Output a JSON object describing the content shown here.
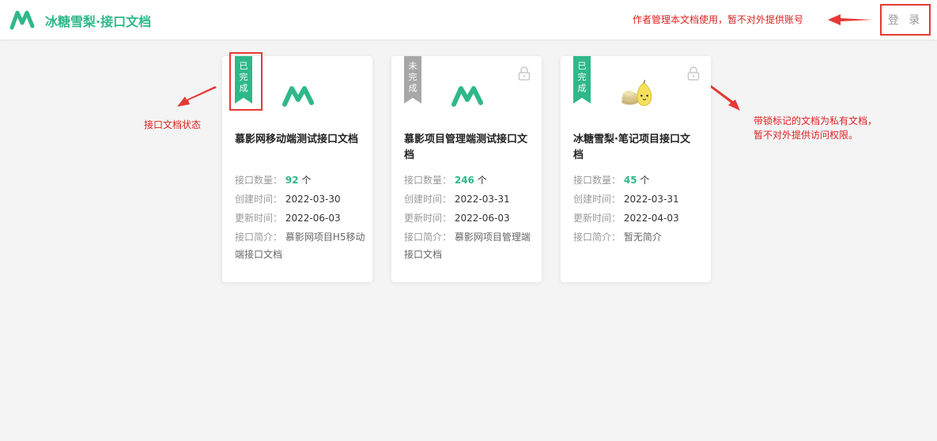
{
  "header": {
    "title": "冰糖雪梨·接口文档",
    "author_note": "作者管理本文档使用，暂不对外提供账号",
    "login_label": "登 录",
    "brand_color": "#2fb889"
  },
  "annotations": {
    "status_note": "接口文档状态",
    "lock_note_line1": "带锁标记的文档为私有文档，",
    "lock_note_line2": "暂不对外提供访问权限。"
  },
  "labels": {
    "count": "接口数量：",
    "count_unit": "个",
    "created": "创建时间：",
    "updated": "更新时间：",
    "desc": "接口简介："
  },
  "cards": [
    {
      "status_1": "已",
      "status_2": "完",
      "status_3": "成",
      "status": "done",
      "logo": "m-logo",
      "locked": false,
      "title": "慕影网移动端测试接口文档",
      "count": "92",
      "created": "2022-03-30",
      "updated": "2022-06-03",
      "desc": "慕影网项目H5移动端接口文档"
    },
    {
      "status_1": "未",
      "status_2": "完",
      "status_3": "成",
      "status": "todo",
      "logo": "m-logo",
      "locked": true,
      "title": "慕影项目管理端测试接口文档",
      "count": "246",
      "created": "2022-03-31",
      "updated": "2022-06-03",
      "desc": "慕影网项目管理端接口文档"
    },
    {
      "status_1": "已",
      "status_2": "完",
      "status_3": "成",
      "status": "done",
      "logo": "pear-mascot",
      "locked": true,
      "title": "冰糖雪梨·笔记项目接口文档",
      "count": "45",
      "created": "2022-03-31",
      "updated": "2022-04-03",
      "desc": "暂无简介"
    }
  ]
}
